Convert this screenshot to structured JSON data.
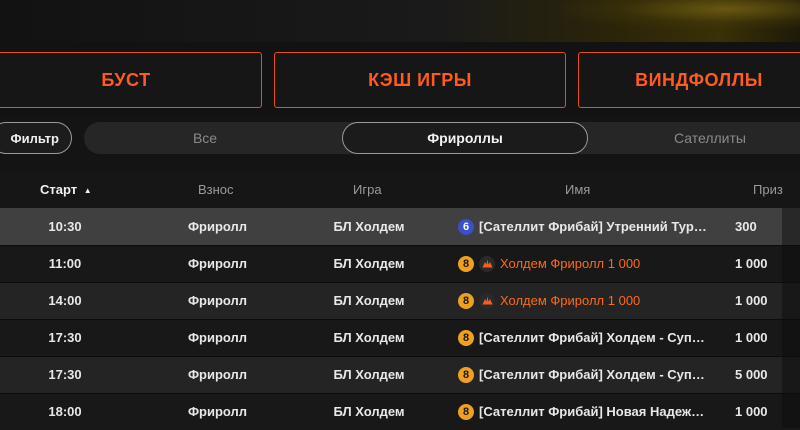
{
  "categories": [
    "БУСТ",
    "КЭШ ИГРЫ",
    "ВИНДФОЛЛЫ"
  ],
  "filter": {
    "label": "Фильтр"
  },
  "segments": [
    {
      "label": "Все",
      "active": false
    },
    {
      "label": "Фрироллы",
      "active": true
    },
    {
      "label": "Сателлиты",
      "active": false
    }
  ],
  "table": {
    "headers": {
      "start": "Старт",
      "sort_indicator": "▲",
      "fee": "Взнос",
      "game": "Игра",
      "name": "Имя",
      "prize": "Приз"
    },
    "rows": [
      {
        "time": "10:30",
        "fee": "Фриролл",
        "game": "БЛ Холдем",
        "badge": "6",
        "badge_color": "blue",
        "has_brand_icon": false,
        "name": "[Сателлит Фрибай] Утренний Турбо...",
        "promo": false,
        "prize": "300"
      },
      {
        "time": "11:00",
        "fee": "Фриролл",
        "game": "БЛ Холдем",
        "badge": "8",
        "badge_color": "orange",
        "has_brand_icon": true,
        "name": "Холдем Фриролл 1 000",
        "promo": true,
        "prize": "1 000"
      },
      {
        "time": "14:00",
        "fee": "Фриролл",
        "game": "БЛ Холдем",
        "badge": "8",
        "badge_color": "orange",
        "has_brand_icon": true,
        "name": "Холдем Фриролл 1 000",
        "promo": true,
        "prize": "1 000"
      },
      {
        "time": "17:30",
        "fee": "Фриролл",
        "game": "БЛ Холдем",
        "badge": "8",
        "badge_color": "orange",
        "has_brand_icon": false,
        "name": "[Сателлит Фрибай] Холдем - Супер...",
        "promo": false,
        "prize": "1 000"
      },
      {
        "time": "17:30",
        "fee": "Фриролл",
        "game": "БЛ Холдем",
        "badge": "8",
        "badge_color": "orange",
        "has_brand_icon": false,
        "name": "[Сателлит Фрибай] Холдем - Супер...",
        "promo": false,
        "prize": "5 000"
      },
      {
        "time": "18:00",
        "fee": "Фриролл",
        "game": "БЛ Холдем",
        "badge": "8",
        "badge_color": "orange",
        "has_brand_icon": false,
        "name": "[Сателлит Фрибай] Новая Надежда...",
        "promo": false,
        "prize": "1 000"
      }
    ]
  },
  "colors": {
    "accent": "#ff5a1f",
    "badge_orange": "#f0a020",
    "badge_blue": "#3d4fc8",
    "selected_row": "#404040"
  }
}
